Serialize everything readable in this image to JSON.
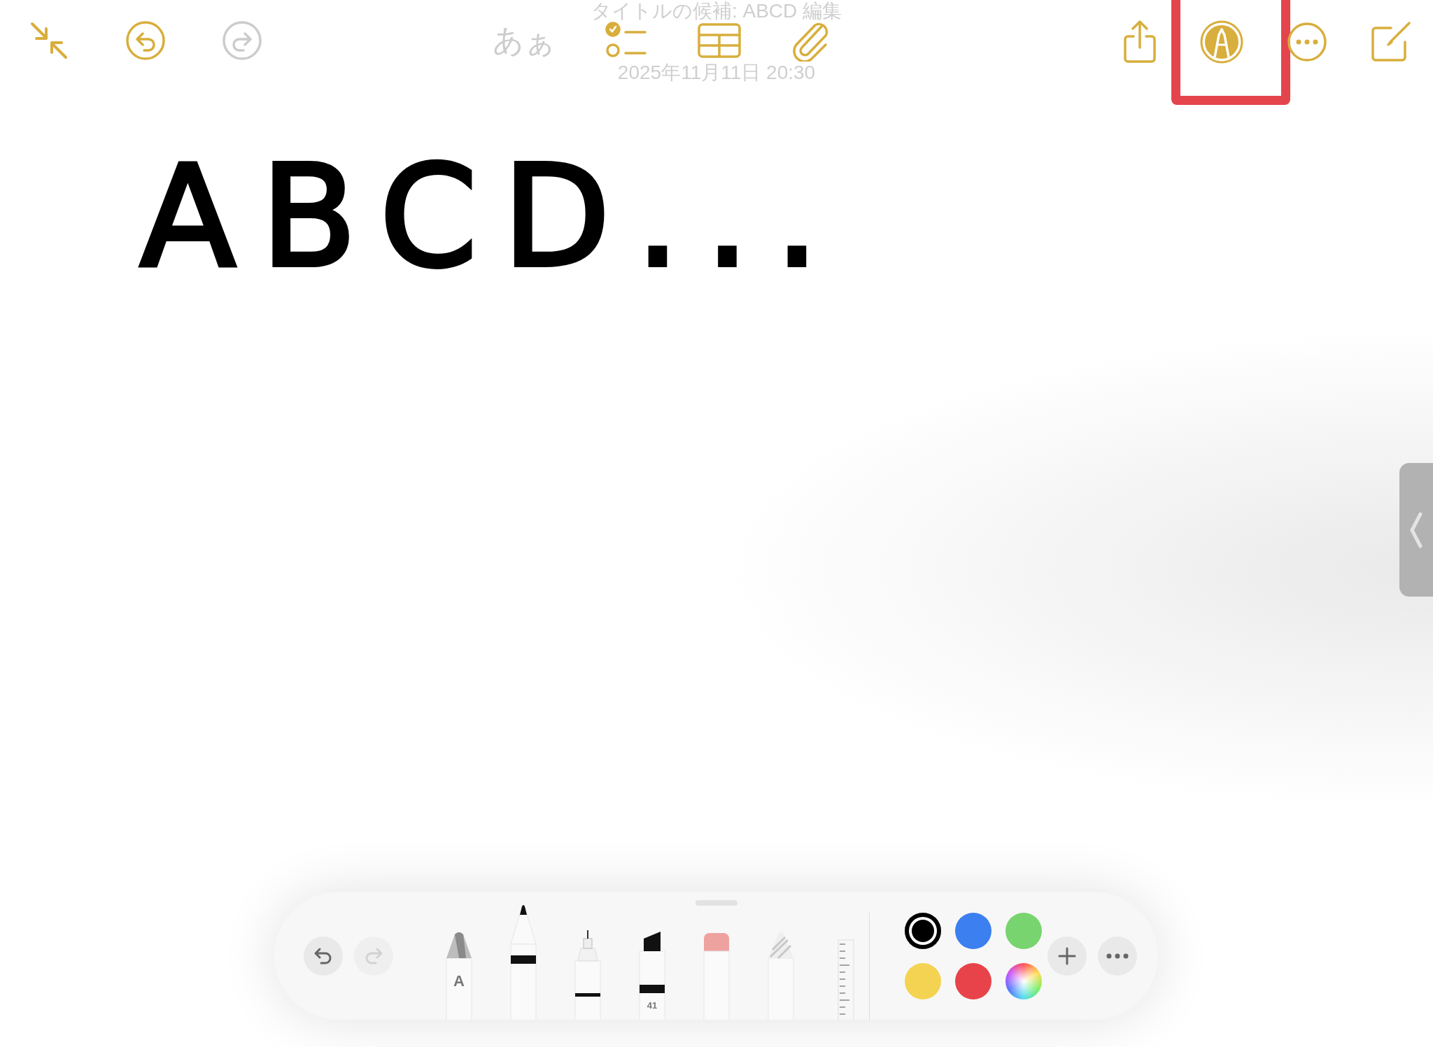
{
  "top_bar": {
    "title_suggestion": "タイトルの候補: ABCD 編集",
    "date": "2025年11月11日 20:30",
    "left_buttons": [
      {
        "kind": "collapse",
        "disabled": false
      },
      {
        "kind": "undo",
        "disabled": false
      },
      {
        "kind": "redo",
        "disabled": true
      }
    ],
    "center_buttons": [
      {
        "kind": "text-style",
        "label": "あぁ",
        "disabled": true
      },
      {
        "kind": "checklist",
        "disabled": false
      },
      {
        "kind": "table",
        "disabled": false
      },
      {
        "kind": "attachment",
        "disabled": false
      }
    ],
    "right_buttons": [
      {
        "kind": "share",
        "highlighted": false
      },
      {
        "kind": "markup",
        "highlighted": true
      },
      {
        "kind": "more",
        "highlighted": false
      },
      {
        "kind": "compose",
        "highlighted": false
      }
    ]
  },
  "canvas": {
    "handwriting": "ABCD..."
  },
  "palette": {
    "undo": {
      "disabled": false
    },
    "redo": {
      "disabled": true
    },
    "tools": [
      {
        "kind": "monoline",
        "label": "A",
        "selected": false
      },
      {
        "kind": "pen",
        "selected": true
      },
      {
        "kind": "fineliner",
        "selected": false
      },
      {
        "kind": "marker",
        "label": "41",
        "selected": false
      },
      {
        "kind": "eraser",
        "selected": false
      },
      {
        "kind": "pencil",
        "selected": false
      },
      {
        "kind": "ruler",
        "selected": false
      }
    ],
    "colors": [
      {
        "kind": "swatch",
        "color": "#000000",
        "selected": true
      },
      {
        "kind": "swatch",
        "color": "#3b7ff0",
        "selected": false
      },
      {
        "kind": "swatch",
        "color": "#78d46e",
        "selected": false
      },
      {
        "kind": "swatch",
        "color": "#f5d352",
        "selected": false
      },
      {
        "kind": "swatch",
        "color": "#e8434a",
        "selected": false
      },
      {
        "kind": "picker",
        "selected": false
      }
    ]
  },
  "side_tab": {
    "expanded": false
  }
}
